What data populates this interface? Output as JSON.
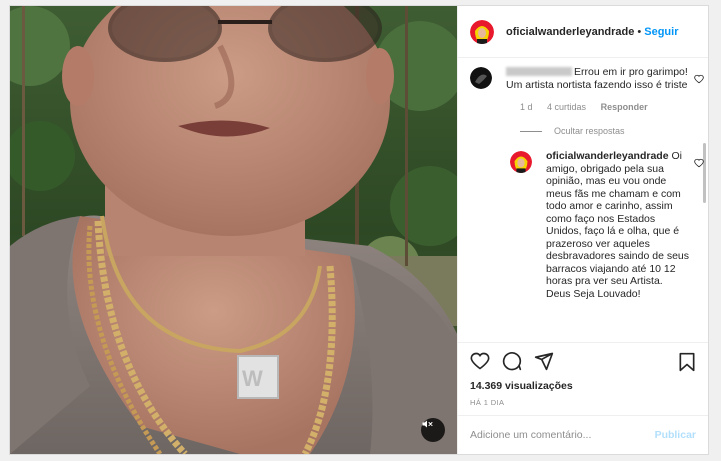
{
  "post": {
    "author": "oficialwanderleyandrade",
    "follow_label": "Seguir",
    "separator": "•"
  },
  "comments": [
    {
      "username_visible": false,
      "text": "Errou em ir pro garimpo! Um artista nortista fazendo isso é triste",
      "time": "1 d",
      "likes": "4 curtidas",
      "reply_label": "Responder",
      "hide_replies_label": "Ocultar respostas"
    }
  ],
  "reply": {
    "username": "oficialwanderleyandrade",
    "text": "Oi amigo, obrigado pela sua opinião, mas eu vou onde meus fãs me chamam e com todo amor e carinho, assim como faço nos Estados Unidos, faço lá e olha, que é prazeroso ver aqueles desbravadores saindo de seus barracos viajando até 10 12 horas pra ver seu Artista. Deus Seja Louvado!"
  },
  "stats": {
    "views": "14.369 visualizações",
    "date": "HÁ 1 DIA"
  },
  "composer": {
    "placeholder": "Adicione um comentário...",
    "publish_label": "Publicar"
  },
  "icons": {
    "like": "heart-icon",
    "comment": "comment-bubble-icon",
    "share": "paper-plane-icon",
    "save": "bookmark-icon",
    "audio": "muted-speaker-icon"
  },
  "colors": {
    "accent": "#0095f6",
    "publish_disabled": "#b2dffc",
    "avatar_bg": "#e8192c",
    "avatar_hair": "#f5d400",
    "muted_text": "#8e8e8e"
  }
}
